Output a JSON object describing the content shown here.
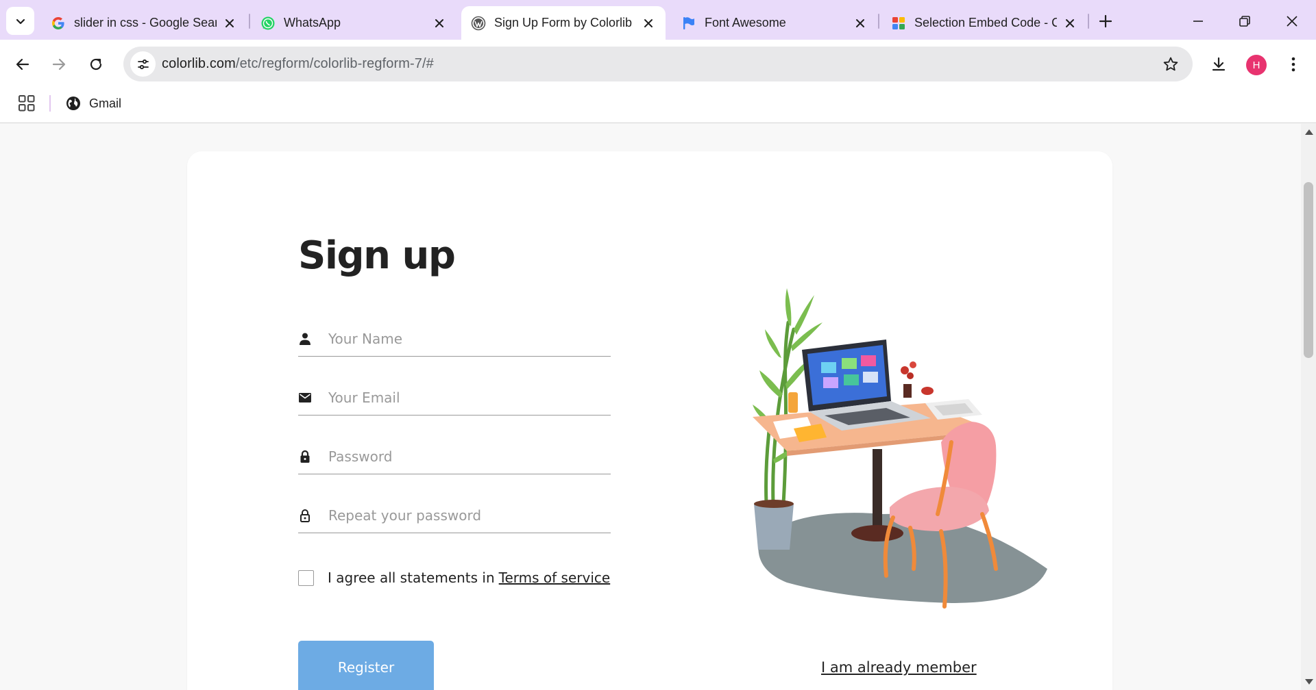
{
  "browser": {
    "tabs": [
      {
        "title": "slider in css - Google Search",
        "favicon": "google-icon",
        "active": false
      },
      {
        "title": "WhatsApp",
        "favicon": "whatsapp-icon",
        "active": false
      },
      {
        "title": "Sign Up Form by Colorlib",
        "favicon": "wordpress-icon",
        "active": true
      },
      {
        "title": "Font Awesome",
        "favicon": "font-awesome-flag-icon",
        "active": false
      },
      {
        "title": "Selection Embed Code - Colorlib",
        "favicon": "selection-app-icon",
        "active": false
      }
    ],
    "url_domain": "colorlib.com",
    "url_path": "/etc/regform/colorlib-regform-7/#",
    "profile_initial": "H",
    "bookmarks": [
      {
        "label": "Gmail",
        "icon": "globe-icon"
      }
    ],
    "colors": {
      "tabstrip": "#e9dbfa",
      "avatar": "#e8336f"
    }
  },
  "form": {
    "title": "Sign up",
    "fields": [
      {
        "placeholder": "Your Name",
        "icon": "person-icon",
        "value": ""
      },
      {
        "placeholder": "Your Email",
        "icon": "envelope-icon",
        "value": ""
      },
      {
        "placeholder": "Password",
        "icon": "lock-icon",
        "value": ""
      },
      {
        "placeholder": "Repeat your password",
        "icon": "lock-outline-icon",
        "value": ""
      }
    ],
    "agree_text": "I agree all statements in",
    "terms_link": "Terms of service",
    "agree_checked": false,
    "register_label": "Register",
    "member_link": "I am already member",
    "colors": {
      "register_button": "#6dabe4",
      "title": "#222222"
    }
  }
}
